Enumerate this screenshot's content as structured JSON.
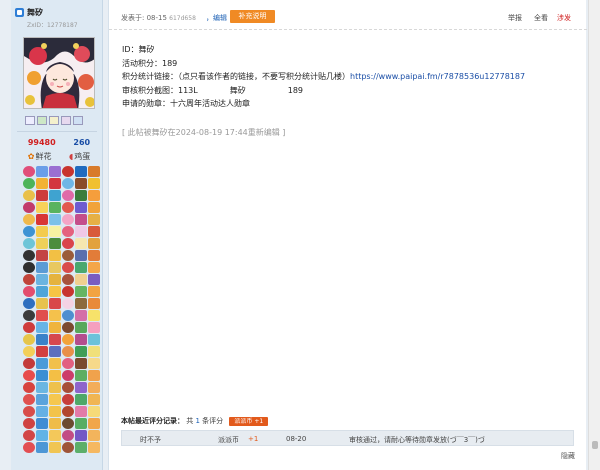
{
  "user": {
    "name": "舞矽",
    "uid": "ZxID：12778187",
    "flowers_count": "99480",
    "eggs_count": "260",
    "flowers_label": "鲜花",
    "eggs_label": "鸡蛋"
  },
  "topbar": {
    "posted": "发表于: 08-15",
    "posted_small": "617d658",
    "edit": "，编辑",
    "supplement": "补充说明",
    "report": "举报",
    "all": "全看",
    "shop": "涉发"
  },
  "post": {
    "line1": "ID：舞矽",
    "line2": "活动积分：189",
    "line3_label": "积分统计链接：（点只看该作者的链接，不要写积分统计贴几楼）",
    "line3_link": "https://www.paipai.fm/r7878536u12778187",
    "line4_label": "审核积分截图：",
    "line4_a": "113L",
    "line4_b": "舞矽",
    "line4_c": "189",
    "line5": "申请的勋章：十六周年活动达人勋章",
    "edited": "[ 此帖被舞矽在2024-08-19 17:44重新编辑 ]"
  },
  "rating": {
    "title": "本帖最近评分记录：",
    "count_prefix": "共",
    "count": "1",
    "count_suffix": "条评分",
    "badge": "派派币 +1",
    "row": {
      "user": "时不予",
      "currency": "派派币",
      "amount": "+1",
      "date": "08-20",
      "reason": "审核通过，请耐心等待勋章发放(づ￣3￣)づ"
    }
  },
  "footer": {
    "hide": "隐藏"
  },
  "colors": {
    "accent": "#f08a24",
    "link": "#1a4ea6",
    "danger": "#d02020",
    "badge": "#e25a1c"
  },
  "medals": [
    "#e04e7a",
    "#6a9ee8",
    "#9a6fd2",
    "#c8342e",
    "#1f6bbf",
    "#d87b2b",
    "#4db45a",
    "#f2b233",
    "#d3363e",
    "#6fb6e6",
    "#8a4d2a",
    "#f0c030",
    "#e9c04a",
    "#cd3b3b",
    "#3fa3d0",
    "#e06aa8",
    "#3a7d3c",
    "#f59e3c",
    "#c23b6b",
    "#f7d25a",
    "#59b35e",
    "#e2594f",
    "#6e5bd0",
    "#f1a33b",
    "#f0b94c",
    "#d83535",
    "#7cc1e8",
    "#f4a4c6",
    "#c44d8b",
    "#e6b045",
    "#3e93d4",
    "#f3cb4e",
    "#f7f2a2",
    "#e4617f",
    "#f0c8e6",
    "#d85a3b",
    "#6ec5d8",
    "#eed05a",
    "#4c8d3c",
    "#d9434c",
    "#f5e7b0",
    "#e2a23d",
    "#333333",
    "#c34444",
    "#f2c044",
    "#9a5c3a",
    "#5a6fae",
    "#e27c39",
    "#2f2f2f",
    "#5b9bd5",
    "#e8c860",
    "#d94b4b",
    "#4aa86f",
    "#f4a64a",
    "#c0443a",
    "#6bb4e0",
    "#e5b33e",
    "#a8523c",
    "#f0d090",
    "#7a5cc0",
    "#e34d6e",
    "#4fa5d8",
    "#f6c545",
    "#c7342f",
    "#65b563",
    "#f2a342",
    "#2e6fbf",
    "#e7c24d",
    "#d9484a",
    "#f4d3e4",
    "#8c6a3d",
    "#e88a3b",
    "#3c3c3c",
    "#e04e4e",
    "#f5c14c",
    "#4e8fd0",
    "#d46fa8",
    "#f7e26a",
    "#cf3c3c",
    "#67b4e6",
    "#efb43e",
    "#7b4a2f",
    "#58a85c",
    "#f5a0bf",
    "#e6c54a",
    "#3a82c9",
    "#d6484e",
    "#f2a33a",
    "#b44d8e",
    "#6cc2da",
    "#f3cf5a",
    "#d3403f",
    "#5b6fbf",
    "#e8904a",
    "#3f9e57",
    "#f0e07a",
    "#c33a3a",
    "#4a9bd8",
    "#f1c04b",
    "#e25f80",
    "#7a4a2e",
    "#f6d98a",
    "#e74c4c",
    "#3b8fd3",
    "#f4bf45",
    "#cc3d6a",
    "#5fae62",
    "#f0a24c",
    "#d7433f",
    "#6ab6e2",
    "#eec14d",
    "#a64f38",
    "#8e64cc",
    "#f3ad5a",
    "#e0504f",
    "#5aa3dc",
    "#f5c74f",
    "#c73f3b",
    "#4ea868",
    "#f0b553",
    "#d84c4a",
    "#65b0e4",
    "#f2c34a",
    "#b2472f",
    "#e37aa8",
    "#f6da78",
    "#cf4242",
    "#3f8cd4",
    "#efbc48",
    "#6c4b30",
    "#59ad63",
    "#f1a64b",
    "#d24646",
    "#62b3e6",
    "#f4c85a",
    "#c24d84",
    "#7458c6",
    "#f3b45c",
    "#e24e52",
    "#4d97d6",
    "#f0c553",
    "#9e5438",
    "#5caf6a",
    "#f5b861"
  ]
}
